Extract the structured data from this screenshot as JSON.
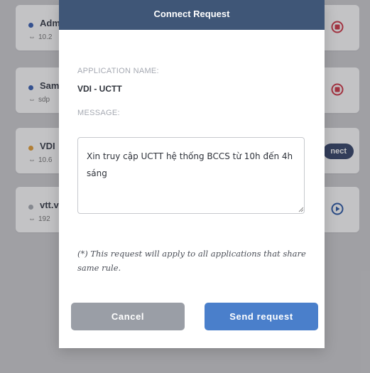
{
  "background_list": {
    "items": [
      {
        "name": "Adm",
        "address": "10.2",
        "dot_color": "#3b62b5",
        "action": "stop"
      },
      {
        "name": "Sam",
        "address": "sdp",
        "dot_color": "#3b62b5",
        "action": "stop"
      },
      {
        "name": "VDI",
        "address": "10.6",
        "dot_color": "#e7a13a",
        "action": "connect",
        "action_label": "nect"
      },
      {
        "name": "vtt.v",
        "address": "192",
        "dot_color": "#a9adb5",
        "action": "play"
      }
    ]
  },
  "modal": {
    "title": "Connect Request",
    "app_name_label": "APPLICATION NAME:",
    "app_name_value": "VDI - UCTT",
    "message_label": "MESSAGE:",
    "message_value": "Xin truy cập UCTT hệ thống BCCS từ 10h đến 4h sáng",
    "note": "(*) This request will apply to all applications that share same rule.",
    "cancel_label": "Cancel",
    "send_label": "Send request"
  },
  "colors": {
    "header_bg": "#3f5677",
    "send_button": "#4a7fcb",
    "cancel_button": "#9a9ea6",
    "stop_icon": "#d23a4a",
    "play_icon": "#2d5aa8",
    "connect_button": "#36466b"
  },
  "icons": [
    "link-icon",
    "stop-icon",
    "play-icon",
    "resize-handle-icon"
  ]
}
